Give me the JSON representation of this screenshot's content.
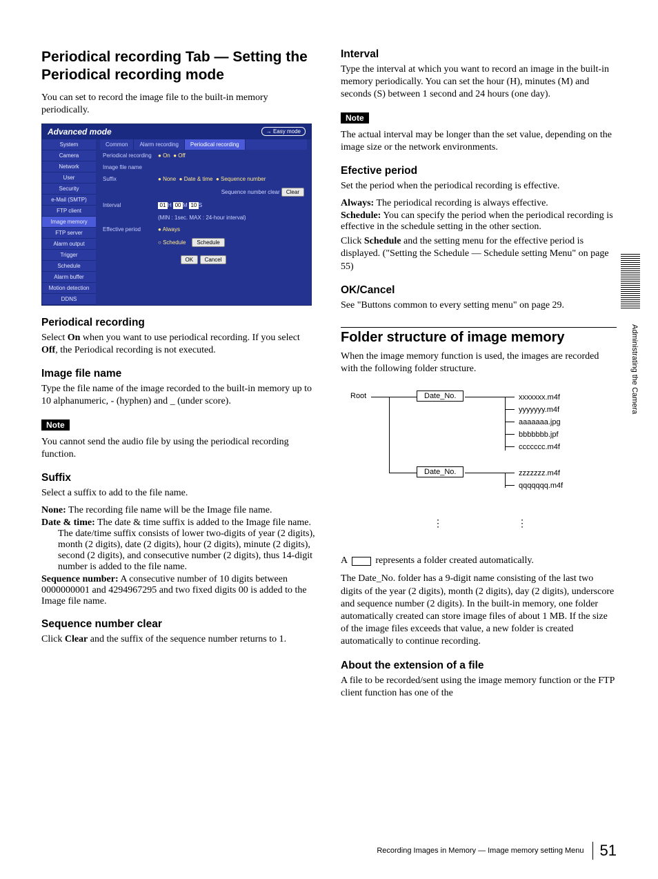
{
  "side": {
    "margin_text": "Administrating the Camera"
  },
  "left": {
    "title": "Periodical recording Tab — Setting the Periodical recording mode",
    "intro": "You can set to record the image file to the built-in memory periodically.",
    "mock": {
      "header_title": "Advanced mode",
      "easy_mode": "→ Easy mode",
      "menu": [
        "System",
        "Camera",
        "Network",
        "User",
        "Security",
        "e-Mail (SMTP)",
        "FTP client",
        "Image memory",
        "FTP server",
        "Alarm output",
        "Trigger",
        "Schedule",
        "Alarm buffer",
        "Motion detection",
        "DDNS"
      ],
      "active_menu_index": 7,
      "tabs": [
        "Common",
        "Alarm recording",
        "Periodical recording"
      ],
      "active_tab_index": 2,
      "rows": {
        "periodical_label": "Periodical recording",
        "on": "On",
        "off": "Off",
        "image_file_label": "Image file name",
        "suffix_label": "Suffix",
        "suffix_none": "None",
        "suffix_date": "Date & time",
        "suffix_seq": "Sequence number",
        "seq_clear_label": "Sequence number clear",
        "clear_btn": "Clear",
        "interval_label": "Interval",
        "unit_h": "H",
        "unit_m": "M",
        "unit_s": "S",
        "h_val": "01",
        "m_val": "00",
        "s_val": "10",
        "interval_hint": "(MIN : 1sec. MAX : 24-hour interval)",
        "effective_label": "Effective period",
        "always": "Always",
        "schedule": "Schedule",
        "schedule_btn": "Schedule",
        "ok": "OK",
        "cancel": "Cancel"
      }
    },
    "h_periodical": "Periodical recording",
    "p_periodical": "Select On when you want to use periodical recording. If you select Off, the Periodical recording is not executed.",
    "h_image": "Image file name",
    "p_image": "Type the file name of the image recorded to the built-in memory up to 10 alphanumeric, - (hyphen) and _ (under score).",
    "note_label": "Note",
    "p_note1": "You cannot send the audio file by using the periodical recording function.",
    "h_suffix": "Suffix",
    "p_suffix": "Select a suffix to add to the file name.",
    "suffix_defs": {
      "none_term": "None:",
      "none_desc": " The recording file name will be the Image file name.",
      "date_term": "Date & time:",
      "date_desc": " The date & time suffix is added to the Image file name.",
      "date_cont": "The date/time suffix consists of lower two-digits of year (2 digits), month (2 digits), date (2 digits), hour (2 digits), minute (2 digits), second (2 digits), and consecutive number (2 digits), thus 14-digit number is added to the file name.",
      "seq_term": "Sequence number:",
      "seq_desc": " A consecutive number of 10 digits between 0000000001 and 4294967295 and two fixed digits 00 is added to the Image file name."
    },
    "h_seq": "Sequence number clear",
    "p_seq": "Click Clear and the suffix of the sequence number returns to 1."
  },
  "right": {
    "h_interval": "Interval",
    "p_interval": "Type the interval at which you want to record an image in the built-in memory periodically. You can set the hour (H), minutes (M) and seconds (S) between 1 second and 24 hours (one day).",
    "note_label": "Note",
    "p_note2": "The actual interval may be longer than the set value, depending on the image size or the network environments.",
    "h_effective": "Efective period",
    "p_effective": "Set the period when the periodical recording is effective.",
    "eff_defs": {
      "always_term": "Always:",
      "always_desc": " The periodical recording is always effective.",
      "schedule_term": "Schedule:",
      "schedule_desc": " You can specify the period when the periodical recording is effective in the schedule setting in the other section."
    },
    "p_click_schedule": "Click Schedule and the setting menu for the effective period is displayed. (\"Setting the Schedule — Schedule setting Menu\" on page 55)",
    "h_okcancel": "OK/Cancel",
    "p_okcancel": "See \"Buttons common to every setting menu\" on page 29.",
    "h_folder": "Folder structure of image memory",
    "p_folder": "When the image memory function is used, the images are recorded with the following folder structure.",
    "diagram": {
      "root": "Root",
      "date": "Date_No.",
      "files1": [
        "xxxxxxx.m4f",
        "yyyyyyy.m4f",
        "aaaaaaa.jpg",
        "bbbbbbb.jpf",
        "ccccccc.m4f"
      ],
      "files2": [
        "zzzzzzz.m4f",
        "qqqqqqq.m4f"
      ]
    },
    "p_symbol_pre": "A ",
    "p_symbol_post": " represents a folder created automatically.",
    "p_folder_desc": "The Date_No. folder has a 9-digit name consisting of the last two digits of the year (2 digits), month (2 digits), day (2 digits), underscore and sequence number (2 digits). In the built-in memory, one folder automatically created can store image files of about 1 MB. If the size of the image files exceeds that value, a new folder is created automatically to continue recording.",
    "h_ext": "About the extension of a file",
    "p_ext": "A file to be recorded/sent using the image memory function or the FTP client function has one of the"
  },
  "footer": {
    "text": "Recording Images in Memory — Image memory setting Menu",
    "page": "51"
  }
}
